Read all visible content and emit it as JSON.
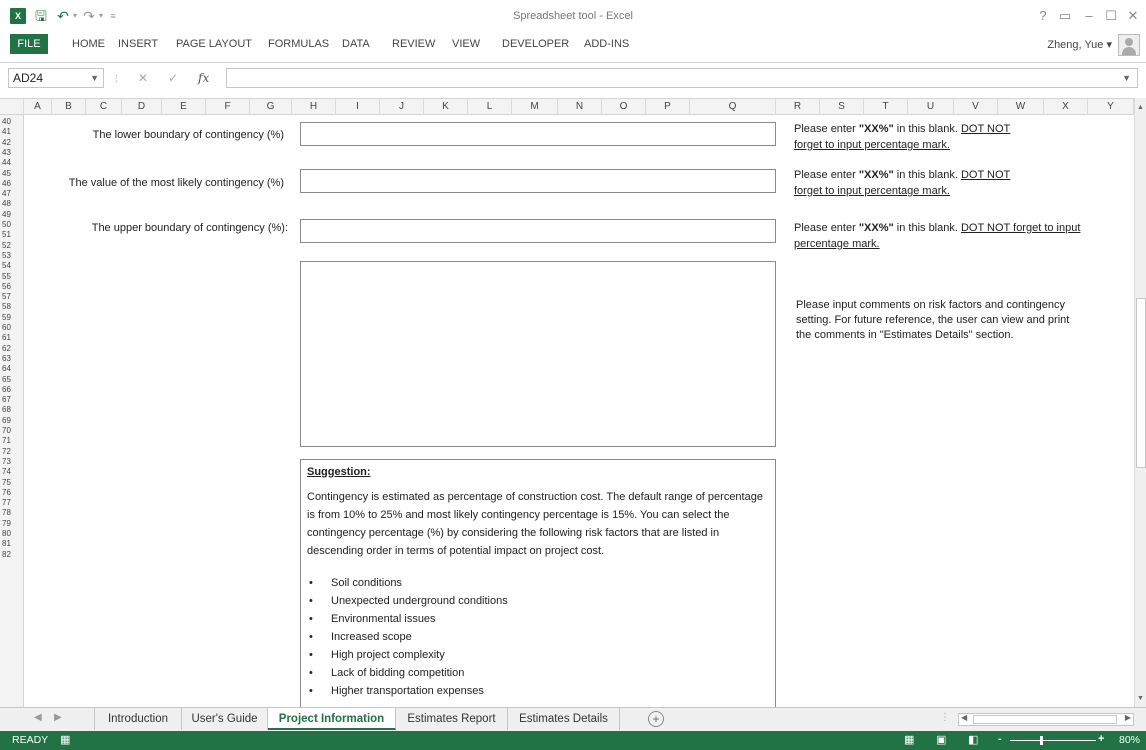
{
  "window": {
    "title": "Spreadsheet tool - Excel",
    "app_logo": "X"
  },
  "qat": {
    "save_icon": "save-icon",
    "undo_icon": "undo-icon",
    "redo_icon": "redo-icon",
    "customize_icon": "customize-icon"
  },
  "window_controls": {
    "help": "?",
    "restore_ribbon": "▭",
    "minimize": "–",
    "maximize": "☐",
    "close": "✕"
  },
  "ribbon": {
    "tabs": [
      "FILE",
      "HOME",
      "INSERT",
      "PAGE LAYOUT",
      "FORMULAS",
      "DATA",
      "REVIEW",
      "VIEW",
      "DEVELOPER",
      "ADD-INS"
    ],
    "account": "Zheng, Yue ▾"
  },
  "formula_bar": {
    "name_box": "AD24",
    "fx": "fx",
    "formula": ""
  },
  "columns": [
    "A",
    "B",
    "C",
    "D",
    "E",
    "F",
    "G",
    "H",
    "I",
    "J",
    "K",
    "L",
    "M",
    "N",
    "O",
    "P",
    "Q",
    "R",
    "S",
    "T",
    "U",
    "V",
    "W",
    "X",
    "Y"
  ],
  "rows": [
    "40",
    "41",
    "42",
    "43",
    "44",
    "45",
    "46",
    "47",
    "48",
    "49",
    "50",
    "51",
    "52",
    "53",
    "54",
    "55",
    "56",
    "57",
    "58",
    "59",
    "60",
    "61",
    "62",
    "63",
    "64",
    "65",
    "66",
    "67",
    "68",
    "69",
    "70",
    "71",
    "72",
    "73",
    "74",
    "75",
    "76",
    "77",
    "78",
    "79",
    "80",
    "81",
    "82"
  ],
  "form": {
    "lower": {
      "label": "The lower boundary of contingency (%)",
      "value": "",
      "note_prefix": "Please enter ",
      "note_bold": "\"XX%\"",
      "note_mid": " in this blank. ",
      "note_underline": "DOT NOT forget to input percentage mark."
    },
    "likely": {
      "label": "The  value of the most likely contingency (%)",
      "value": "",
      "note_prefix": "Please enter ",
      "note_bold": "\"XX%\"",
      "note_mid": " in this blank. ",
      "note_underline": "DOT NOT forget to input percentage mark."
    },
    "upper": {
      "label": "The upper  boundary  of contingency (%):",
      "value": "",
      "note_prefix": "Please enter ",
      "note_bold": "\"XX%\"",
      "note_mid": " in this blank. ",
      "note_underline": "DOT NOT forget to input percentage mark."
    },
    "comments": {
      "value": "",
      "note": "Please input comments on risk factors and contingency setting. For future reference, the user can view and print the comments in \"Estimates Details\" section."
    }
  },
  "suggestion": {
    "title": "Suggestion:",
    "body": "Contingency is estimated as percentage of construction cost.  The default range of percentage is from 10% to 25% and most likely contingency percentage is 15%.  You can select the contingency percentage (%) by considering the following risk factors that are listed in descending order in terms of potential impact on project cost.",
    "factors": [
      "Soil conditions",
      "Unexpected underground conditions",
      "Environmental issues",
      "Increased scope",
      "High project complexity",
      "Lack of bidding competition",
      "Higher transportation expenses"
    ]
  },
  "sheets": {
    "tabs": [
      "Introduction",
      "User's Guide",
      "Project Information",
      "Estimates Report",
      "Estimates Details"
    ],
    "active": "Project Information",
    "add": "+"
  },
  "status": {
    "text": "READY",
    "zoom": "80%",
    "zoom_minus": "-",
    "zoom_plus": "+"
  }
}
